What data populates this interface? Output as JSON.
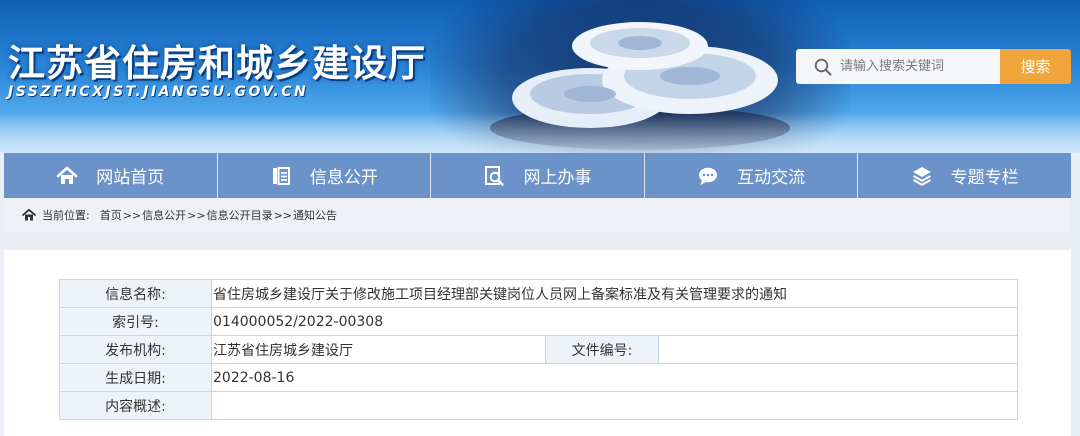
{
  "header": {
    "title": "江苏省住房和城乡建设厅",
    "domain": "JSSZFHCXJST.JIANGSU.GOV.CN",
    "search_placeholder": "请输入搜索关键词",
    "search_button": "搜索"
  },
  "nav": {
    "items": [
      {
        "label": "网站首页",
        "icon": "home-icon"
      },
      {
        "label": "信息公开",
        "icon": "document-list-icon"
      },
      {
        "label": "网上办事",
        "icon": "search-doc-icon"
      },
      {
        "label": "互动交流",
        "icon": "chat-icon"
      },
      {
        "label": "专题专栏",
        "icon": "layers-icon"
      }
    ]
  },
  "breadcrumb": {
    "label": "当前位置:",
    "items": [
      "首页",
      "信息公开",
      "信息公开目录",
      "通知公告"
    ],
    "separator": ">>"
  },
  "info_table": {
    "name_label": "信息名称:",
    "name_value": "省住房城乡建设厅关于修改施工项目经理部关键岗位人员网上备案标准及有关管理要求的通知",
    "index_label": "索引号:",
    "index_value": "014000052/2022-00308",
    "publisher_label": "发布机构:",
    "publisher_value": "江苏省住房城乡建设厅",
    "doc_no_label": "文件编号:",
    "doc_no_value": "",
    "date_label": "生成日期:",
    "date_value": "2022-08-16",
    "summary_label": "内容概述:",
    "summary_value": ""
  },
  "colors": {
    "nav_bg": "#6c93c9",
    "search_button": "#f0a43c",
    "banner_top": "#0f5fb5"
  }
}
